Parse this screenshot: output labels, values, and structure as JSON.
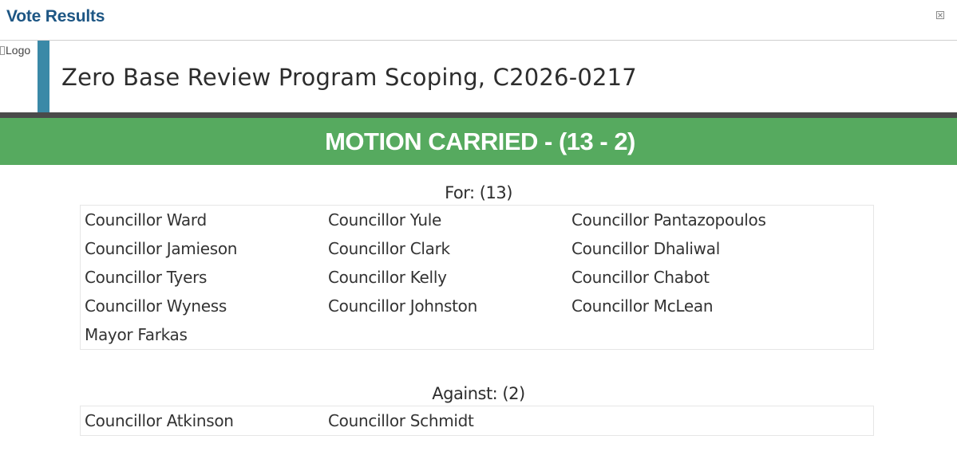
{
  "dialog": {
    "title": "Vote Results",
    "close_icon": "close-icon"
  },
  "banner": {
    "logo_alt": "Logo",
    "item_title": "Zero Base Review Program Scoping, C2026-0217",
    "accent_color": "#3a89a7"
  },
  "result": {
    "text": "MOTION CARRIED - (13 - 2)",
    "color": "#56aa5f"
  },
  "for_group": {
    "heading": "For: (13)",
    "members": [
      "Councillor Ward",
      "Councillor Yule",
      "Councillor Pantazopoulos",
      "Councillor Jamieson",
      "Councillor Clark",
      "Councillor Dhaliwal",
      "Councillor Tyers",
      "Councillor Kelly",
      "Councillor Chabot",
      "Councillor Wyness",
      "Councillor Johnston",
      "Councillor McLean",
      "Mayor Farkas"
    ]
  },
  "against_group": {
    "heading": "Against: (2)",
    "members": [
      "Councillor Atkinson",
      "Councillor Schmidt"
    ]
  }
}
